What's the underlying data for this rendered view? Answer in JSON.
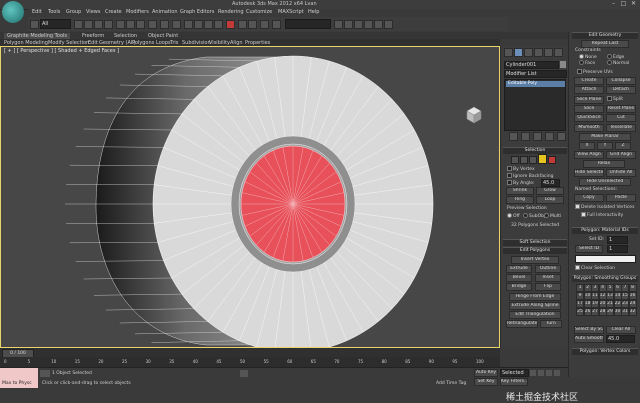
{
  "window": {
    "title": "Autodesk 3ds Max  2012 x64     Lvan",
    "controls": [
      "–",
      "□",
      "✕"
    ]
  },
  "menubar": {
    "items": [
      "Edit",
      "Tools",
      "Group",
      "Views",
      "Create",
      "Modifiers",
      "Animation",
      "Graph Editors",
      "Rendering",
      "Customize",
      "MAXScript",
      "Help"
    ]
  },
  "toolbar": {
    "selection_filter": "All"
  },
  "ribbon": {
    "tabs": [
      "Graphite Modeling Tools",
      "Freeform",
      "Selection",
      "Object Paint"
    ],
    "panels": [
      "Polygon Modeling",
      "Modify Selection",
      "Edit",
      "Geometry (All)",
      "Polygons",
      "Loops",
      "Tris",
      "Subdivision",
      "Visibility",
      "Align",
      "Properties"
    ]
  },
  "viewport": {
    "label": "[ + ] [ Perspective ] [ Shaded + Edged Faces ]"
  },
  "command_panel": {
    "object_name": "Cylinder001",
    "modifier_list_label": "Modifier List",
    "stack_item": "Editable Poly",
    "selection_header": "Selection",
    "by_vertex": "By Vertex",
    "ignore_backfacing": "Ignore Backfacing",
    "by_angle": "By Angle:",
    "by_angle_value": "45.0",
    "shrink": "Shrink",
    "grow": "Grow",
    "ring": "Ring",
    "loop": "Loop",
    "preview_selection": "Preview Selection",
    "preview_options": [
      "Off",
      "SubObj",
      "Multi"
    ],
    "selected_count": "32 Polygons Selected",
    "soft_selection_header": "Soft Selection",
    "edit_polygons_header": "Edit Polygons",
    "insert_vertex": "Insert Vertex",
    "extrude": "Extrude",
    "outline": "Outline",
    "bevel": "Bevel",
    "inset": "Inset",
    "bridge": "Bridge",
    "flip": "Flip",
    "hinge_from_edge": "Hinge From Edge",
    "extrude_along_spline": "Extrude Along Spline",
    "edit_triangulation": "Edit Triangulation",
    "retriangulate": "Retriangulate",
    "turn": "Turn"
  },
  "right_panel": {
    "edit_geometry_header": "Edit Geometry",
    "repeat_last": "Repeat Last",
    "constraints": "Constraints",
    "constraint_options": [
      "None",
      "Edge",
      "Face",
      "Normal"
    ],
    "preserve_uvs": "Preserve UVs",
    "create": "Create",
    "collapse": "Collapse",
    "attach": "Attach",
    "detach": "Detach",
    "slice_plane": "Slice Plane",
    "split": "Split",
    "slice": "Slice",
    "reset_plane": "Reset Plane",
    "quickslice": "QuickSlice",
    "cut": "Cut",
    "msmooth": "MSmooth",
    "tessellate": "Tessellate",
    "make_planar": "Make Planar",
    "x": "X",
    "y": "Y",
    "z": "Z",
    "view_align": "View Align",
    "grid_align": "Grid Align",
    "relax": "Relax",
    "hide_selected": "Hide Selected",
    "unhide_all": "Unhide All",
    "hide_unselected": "Hide Unselected",
    "named_selections": "Named Selections:",
    "copy": "Copy",
    "paste": "Paste",
    "delete_isolated": "Delete Isolated Vertices",
    "full_interactivity": "Full Interactivity",
    "material_ids_header": "Polygon: Material IDs",
    "set_id": "Set ID:",
    "set_id_value": "1",
    "select_id": "Select ID",
    "select_id_value": "1",
    "clear_selection": "Clear Selection",
    "smoothing_groups_header": "Polygon: Smoothing Groups",
    "smoothing_numbers": [
      "1",
      "2",
      "3",
      "4",
      "5",
      "6",
      "7",
      "8",
      "9",
      "10",
      "11",
      "12",
      "13",
      "14",
      "15",
      "16",
      "17",
      "18",
      "19",
      "20",
      "21",
      "22",
      "23",
      "24",
      "25",
      "26",
      "27",
      "28",
      "29",
      "30",
      "31",
      "32"
    ],
    "select_by_sg": "Select By SG",
    "clear_all": "Clear All",
    "auto_smooth": "Auto Smooth",
    "auto_smooth_value": "45.0",
    "vertex_colors_header": "Polygon: Vertex Colors"
  },
  "timeline": {
    "frame_display": "0 / 100",
    "ticks": [
      "0",
      "5",
      "10",
      "15",
      "20",
      "25",
      "30",
      "35",
      "40",
      "45",
      "50",
      "55",
      "60",
      "65",
      "70",
      "75",
      "80",
      "85",
      "90",
      "95",
      "100"
    ]
  },
  "status": {
    "maxscript_label": "Max to Physc",
    "selected_text": "1 Object Selected",
    "prompt_text": "Click or click-and-drag to select objects",
    "add_time_tag": "Add Time Tag",
    "auto_key": "Auto Key",
    "set_key": "Set Key",
    "selected_dropdown": "Selected",
    "key_filters": "Key Filters...",
    "watermark": "稀土掘金技术社区"
  },
  "colors": {
    "selection_red": "#e8505a",
    "viewport_bg": "#474747",
    "cylinder_face": "#dcdcdc",
    "accent_yellow": "#e8d46a"
  }
}
